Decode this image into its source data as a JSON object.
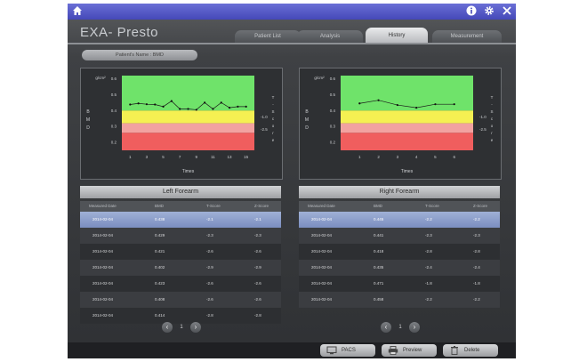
{
  "app_title": "EXA- Presto",
  "icons": {
    "home": "home-icon",
    "info": "info-icon",
    "settings": "gear-icon",
    "close": "close-icon"
  },
  "tabs": [
    {
      "label": "Patient List",
      "active": false
    },
    {
      "label": "Analysis",
      "active": false
    },
    {
      "label": "History",
      "active": true
    },
    {
      "label": "Measurement",
      "active": false
    }
  ],
  "patient_pill": "Patient's Name : BMD",
  "left": {
    "chart_data": {
      "type": "line",
      "ylabel_unit": "g/cm²",
      "ylabel": "BMD",
      "xlabel": "Times",
      "right_label": "T-Score",
      "y_ticks": [
        "0.6",
        "0.5",
        "0.4",
        "0.3",
        "0.2"
      ],
      "right_ticks": [
        "-1.0",
        "-2.5"
      ],
      "x_ticks": [
        "1",
        "3",
        "5",
        "7",
        "9",
        "11",
        "13",
        "15"
      ],
      "ylim": [
        0.15,
        0.62
      ],
      "xlim": [
        0,
        16
      ],
      "bands": [
        {
          "from": 0.4,
          "to": 0.62,
          "color": "#6fe36a"
        },
        {
          "from": 0.32,
          "to": 0.4,
          "color": "#f5f052"
        },
        {
          "from": 0.26,
          "to": 0.32,
          "color": "#f2a2a0"
        },
        {
          "from": 0.15,
          "to": 0.26,
          "color": "#f05e5e"
        }
      ],
      "x": [
        1,
        2,
        3,
        4,
        5,
        6,
        7,
        8,
        9,
        10,
        11,
        12,
        13,
        14,
        15
      ],
      "values": [
        0.438,
        0.445,
        0.44,
        0.438,
        0.425,
        0.46,
        0.41,
        0.41,
        0.405,
        0.45,
        0.41,
        0.45,
        0.418,
        0.425,
        0.425
      ]
    },
    "section_title": "Left Forearm",
    "columns": [
      "Measured Date",
      "BMD",
      "T-Score",
      "Z-Score"
    ],
    "rows": [
      [
        "2014-02-04",
        "0.438",
        "-2.1",
        "-2.1"
      ],
      [
        "2014-02-04",
        "0.429",
        "-2.3",
        "-2.3"
      ],
      [
        "2014-02-04",
        "0.421",
        "-2.6",
        "-2.6"
      ],
      [
        "2014-02-04",
        "0.402",
        "-2.9",
        "-2.9"
      ],
      [
        "2014-02-04",
        "0.423",
        "-2.6",
        "-2.6"
      ],
      [
        "2014-02-04",
        "0.408",
        "-2.6",
        "-2.6"
      ],
      [
        "2014-02-04",
        "0.414",
        "-2.8",
        "-2.8"
      ]
    ],
    "page": "1"
  },
  "right": {
    "chart_data": {
      "type": "line",
      "ylabel_unit": "g/cm²",
      "ylabel": "BMD",
      "xlabel": "Times",
      "right_label": "T-Score",
      "y_ticks": [
        "0.6",
        "0.5",
        "0.4",
        "0.3",
        "0.2"
      ],
      "right_ticks": [
        "-1.0",
        "-2.5"
      ],
      "x_ticks": [
        "1",
        "2",
        "3",
        "4",
        "5",
        "6"
      ],
      "ylim": [
        0.15,
        0.62
      ],
      "xlim": [
        0,
        7
      ],
      "bands": [
        {
          "from": 0.4,
          "to": 0.62,
          "color": "#6fe36a"
        },
        {
          "from": 0.32,
          "to": 0.4,
          "color": "#f5f052"
        },
        {
          "from": 0.26,
          "to": 0.32,
          "color": "#f2a2a0"
        },
        {
          "from": 0.15,
          "to": 0.26,
          "color": "#f05e5e"
        }
      ],
      "x": [
        1,
        2,
        3,
        4,
        5,
        6
      ],
      "values": [
        0.445,
        0.465,
        0.435,
        0.418,
        0.44,
        0.44
      ]
    },
    "section_title": "Right Forearm",
    "columns": [
      "Measured Date",
      "BMD",
      "T-Score",
      "Z-Score"
    ],
    "rows": [
      [
        "2014-02-04",
        "0.445",
        "-2.2",
        "-2.2"
      ],
      [
        "2014-02-04",
        "0.441",
        "-2.3",
        "-2.3"
      ],
      [
        "2014-02-04",
        "0.418",
        "-2.8",
        "-2.8"
      ],
      [
        "2014-02-04",
        "0.435",
        "-2.4",
        "-2.4"
      ],
      [
        "2014-02-04",
        "0.471",
        "-1.8",
        "-1.8"
      ],
      [
        "2014-02-04",
        "0.458",
        "-2.2",
        "-2.2"
      ]
    ],
    "page": "1"
  },
  "buttons": {
    "pacs": "PACS",
    "preview": "Preview",
    "delete": "Delete"
  }
}
